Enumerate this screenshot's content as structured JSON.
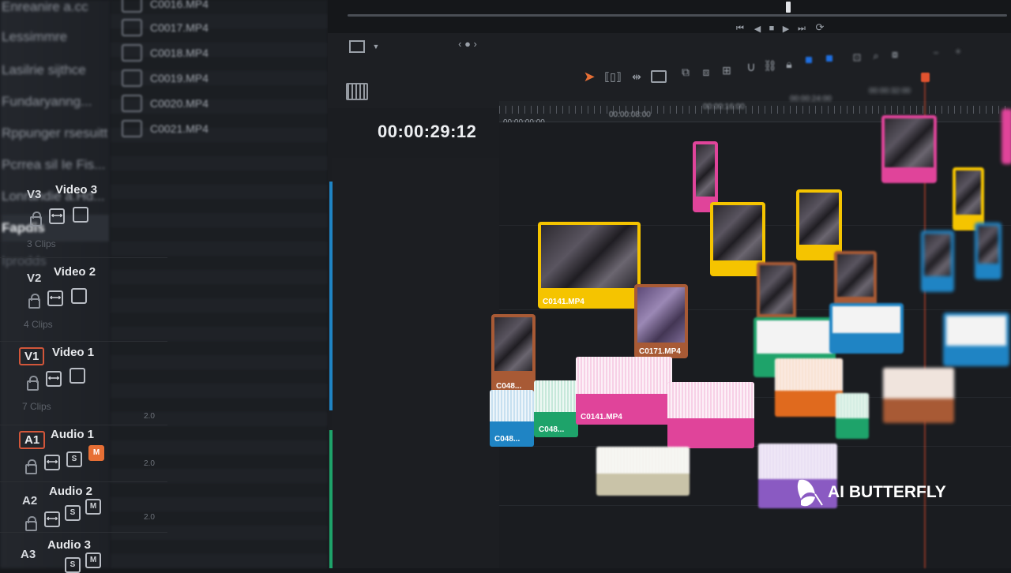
{
  "media_pool": {
    "items": [
      {
        "label": "Enreanire a.cc"
      },
      {
        "label": "Lessimmre"
      },
      {
        "label": "Lasilrie sijthce"
      },
      {
        "label": "Fundaryanng..."
      },
      {
        "label": "Rppunger rsesuitt"
      },
      {
        "label": "Pcrrea sil Ie Fis..."
      },
      {
        "label": "Lonrandie a.Hd..."
      },
      {
        "label": "Fapdis"
      },
      {
        "label": "Iprodds"
      }
    ]
  },
  "clip_list": {
    "items": [
      {
        "label": "C0016.MP4"
      },
      {
        "label": "C0017.MP4"
      },
      {
        "label": "C0018.MP4"
      },
      {
        "label": "C0019.MP4"
      },
      {
        "label": "C0020.MP4"
      },
      {
        "label": "C0021.MP4"
      }
    ]
  },
  "viewer": {
    "page_nav": "‹ ● ›"
  },
  "timeline": {
    "timecode": "00:00:29:12",
    "ruler": [
      "00:00:00:00",
      "00:00:08:00",
      "00:00:16:00",
      "00:00:24:00",
      "00:00:32:00"
    ],
    "tracks": [
      {
        "id": "V3",
        "name": "Video 3",
        "sub": "3 Clips"
      },
      {
        "id": "V2",
        "name": "Video 2",
        "sub": "4 Clips"
      },
      {
        "id": "V1",
        "name": "Video 1",
        "sub": "7 Clips"
      },
      {
        "id": "A1",
        "name": "Audio 1",
        "level": "2.0",
        "solo": "S",
        "mute": "M"
      },
      {
        "id": "A2",
        "name": "Audio 2",
        "level": "2.0",
        "solo": "S",
        "mute": "M"
      },
      {
        "id": "A3",
        "name": "Audio 3",
        "level": "2.0",
        "solo": "S",
        "mute": "M"
      }
    ],
    "clips": {
      "v2_main": "C0141.MP4",
      "v1_main": "C048...",
      "v1_purple": "C0171.MP4",
      "a1_blue": "C048...",
      "a1_green": "C048...",
      "a1_pink": "C0141.MP4"
    }
  },
  "colors": {
    "accent_orange": "#e76f35",
    "playhead": "#d84a2a",
    "clip_yellow": "#f5c400",
    "clip_pink": "#e0449a",
    "clip_green": "#1ea36a",
    "clip_blue": "#1f84c4",
    "clip_orange": "#e06a1e",
    "clip_purple": "#8a5ac2",
    "clip_brown": "#a85a35",
    "clip_beige": "#c9c3a8"
  },
  "watermark": {
    "text": "AI BUTTERFLY",
    "icon": "butterfly-icon"
  }
}
